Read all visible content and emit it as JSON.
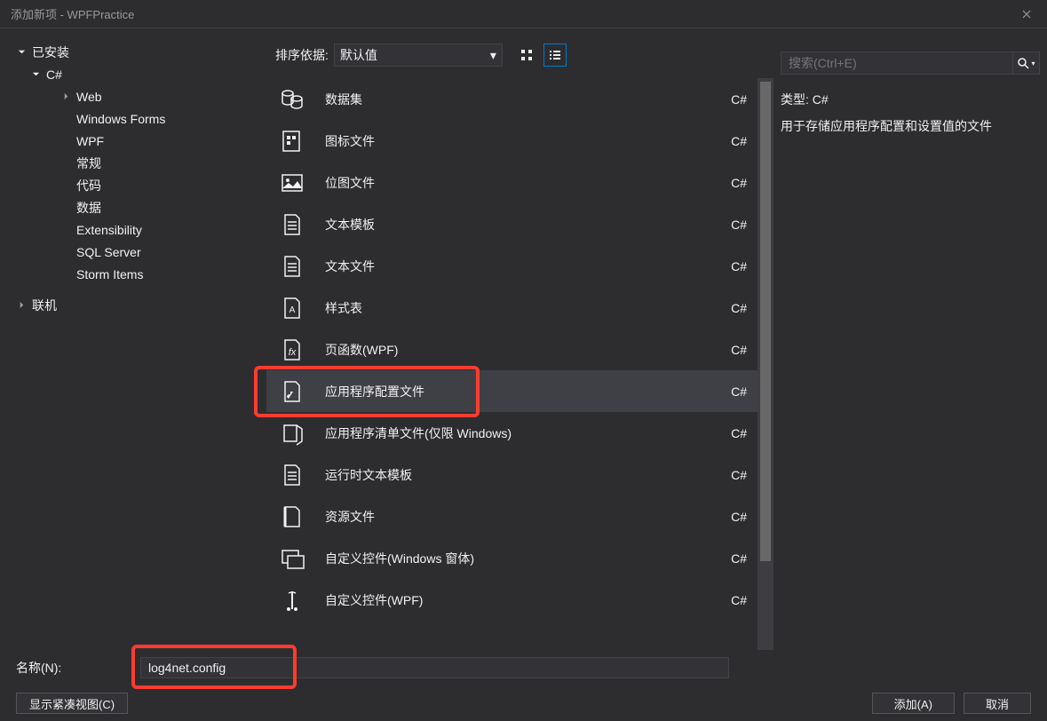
{
  "window": {
    "title": "添加新项 - WPFPractice"
  },
  "sidebar": {
    "installed": "已安装",
    "csharp": "C#",
    "items": [
      "Web",
      "Windows Forms",
      "WPF",
      "常规",
      "代码",
      "数据",
      "Extensibility",
      "SQL Server",
      "Storm Items"
    ],
    "online": "联机"
  },
  "sort": {
    "label": "排序依据:",
    "value": "默认值"
  },
  "templates": [
    {
      "name": "数据集",
      "lang": "C#",
      "icon": "dataset"
    },
    {
      "name": "图标文件",
      "lang": "C#",
      "icon": "iconfile"
    },
    {
      "name": "位图文件",
      "lang": "C#",
      "icon": "bitmap"
    },
    {
      "name": "文本模板",
      "lang": "C#",
      "icon": "doc"
    },
    {
      "name": "文本文件",
      "lang": "C#",
      "icon": "doc"
    },
    {
      "name": "样式表",
      "lang": "C#",
      "icon": "stylesheet"
    },
    {
      "name": "页函数(WPF)",
      "lang": "C#",
      "icon": "pagefn"
    },
    {
      "name": "应用程序配置文件",
      "lang": "C#",
      "icon": "config",
      "selected": true
    },
    {
      "name": "应用程序清单文件(仅限 Windows)",
      "lang": "C#",
      "icon": "manifest"
    },
    {
      "name": "运行时文本模板",
      "lang": "C#",
      "icon": "doc"
    },
    {
      "name": "资源文件",
      "lang": "C#",
      "icon": "resource"
    },
    {
      "name": "自定义控件(Windows 窗体)",
      "lang": "C#",
      "icon": "customwin"
    },
    {
      "name": "自定义控件(WPF)",
      "lang": "C#",
      "icon": "customwpf"
    }
  ],
  "search": {
    "placeholder": "搜索(Ctrl+E)"
  },
  "info": {
    "type_label": "类型:",
    "type_value": "C#",
    "description": "用于存储应用程序配置和设置值的文件"
  },
  "name_field": {
    "label": "名称(N):",
    "value": "log4net.config"
  },
  "buttons": {
    "compact": "显示紧凑视图(C)",
    "add": "添加(A)",
    "cancel": "取消"
  }
}
